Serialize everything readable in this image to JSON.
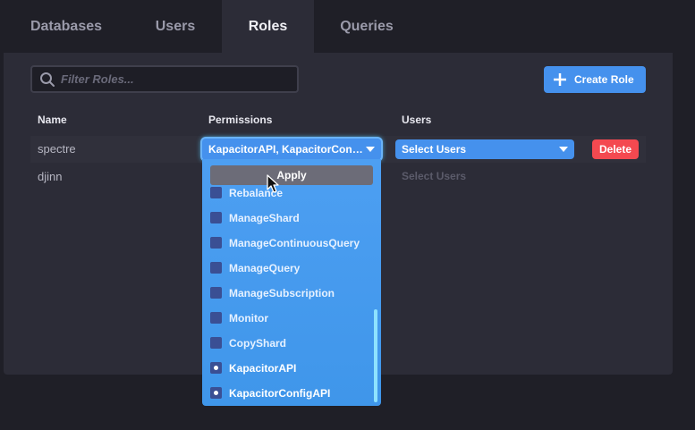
{
  "tabs": [
    {
      "label": "Databases",
      "active": false
    },
    {
      "label": "Users",
      "active": false
    },
    {
      "label": "Roles",
      "active": true
    },
    {
      "label": "Queries",
      "active": false
    }
  ],
  "search": {
    "placeholder": "Filter Roles...",
    "value": "",
    "icon": "search-icon"
  },
  "create_button": {
    "label": "Create Role",
    "icon": "plus-icon"
  },
  "table": {
    "headers": {
      "name": "Name",
      "permissions": "Permissions",
      "users": "Users"
    },
    "rows": [
      {
        "name": "spectre",
        "permissions": "KapacitorAPI, KapacitorConfigAPI",
        "users": "Select Users",
        "delete_label": "Delete"
      },
      {
        "name": "djinn",
        "users": "Select Users"
      }
    ]
  },
  "permissions_menu": {
    "apply_label": "Apply",
    "items": [
      {
        "label": "Rebalance",
        "checked": false
      },
      {
        "label": "ManageShard",
        "checked": false
      },
      {
        "label": "ManageContinuousQuery",
        "checked": false
      },
      {
        "label": "ManageQuery",
        "checked": false
      },
      {
        "label": "ManageSubscription",
        "checked": false
      },
      {
        "label": "Monitor",
        "checked": false
      },
      {
        "label": "CopyShard",
        "checked": false
      },
      {
        "label": "KapacitorAPI",
        "checked": true
      },
      {
        "label": "KapacitorConfigAPI",
        "checked": true
      }
    ]
  },
  "colors": {
    "background": "#1f1f27",
    "panel": "#2c2c37",
    "primary": "#4591ed",
    "danger": "#f44950",
    "checkbox": "#3a4f94"
  }
}
